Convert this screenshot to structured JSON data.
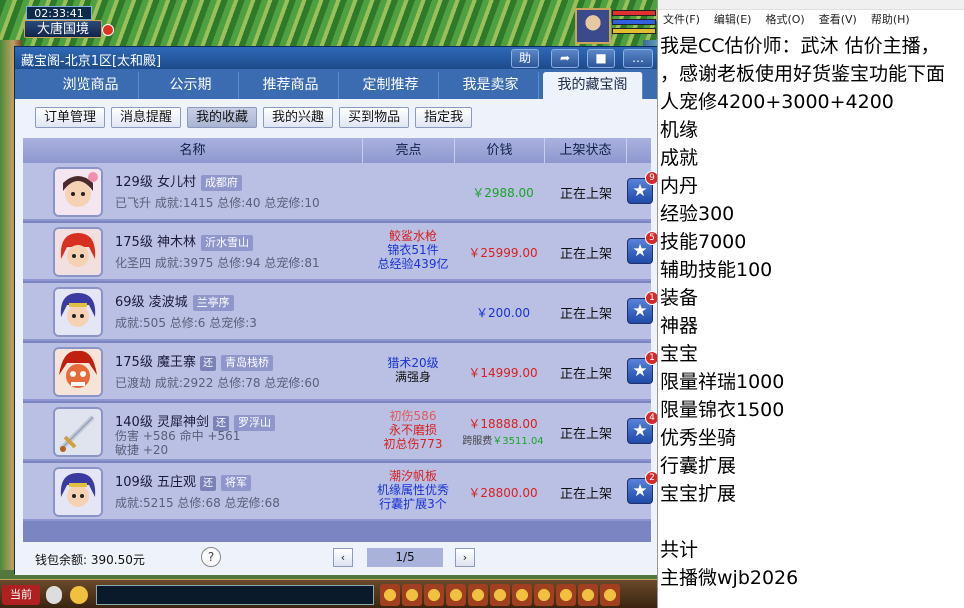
{
  "game": {
    "clock": "02:33:41",
    "map_name": "大唐国境"
  },
  "window": {
    "title": "藏宝阁-北京1区[太和殿]",
    "title_buttons": [
      "助"
    ],
    "tabs": [
      {
        "label": "浏览商品"
      },
      {
        "label": "公示期"
      },
      {
        "label": "推荐商品"
      },
      {
        "label": "定制推荐"
      },
      {
        "label": "我是卖家"
      },
      {
        "label": "我的藏宝阁"
      }
    ],
    "active_tab": "我的藏宝阁",
    "subtabs": [
      "订单管理",
      "消息提醒",
      "我的收藏",
      "我的兴趣",
      "买到物品",
      "指定我"
    ],
    "active_subtab": "我的收藏"
  },
  "table": {
    "headers": {
      "name": "名称",
      "highlight": "亮点",
      "price": "价钱",
      "status": "上架状态"
    },
    "rows": [
      {
        "line1_name": "129级  女儿村",
        "server": "成都府",
        "huan": "",
        "line2": "已飞升  成就:1415  总修:40  总宠修:10",
        "highlights": [],
        "price": "￥2988.00",
        "price_color": "#1aa32a",
        "fee": "",
        "status": "正在上架",
        "fav_count": "9",
        "avatar": "girl"
      },
      {
        "line1_name": "175级  神木林",
        "server": "沂水雪山",
        "huan": "",
        "line2": "化圣四  成就:3975  总修:94  总宠修:81",
        "highlights": [
          {
            "text": "鲛鲨水枪",
            "color": "#d82020"
          },
          {
            "text": "锦衣51件",
            "color": "#1a30d0"
          },
          {
            "text": "总经验439亿",
            "color": "#1a30d0"
          }
        ],
        "price": "￥25999.00",
        "price_color": "#d82020",
        "fee": "",
        "status": "正在上架",
        "fav_count": "5",
        "avatar": "red"
      },
      {
        "line1_name": "69级  凌波城",
        "server": "兰亭序",
        "huan": "",
        "line2": "成就:505  总修:6  总宠修:3",
        "highlights": [],
        "price": "￥200.00",
        "price_color": "#1a30d0",
        "fee": "",
        "status": "正在上架",
        "fav_count": "1",
        "avatar": "blue"
      },
      {
        "line1_name": "175级  魔王寨",
        "server": "青岛栈桥",
        "huan": "还",
        "line2": "已渡劫  成就:2922  总修:78  总宠修:60",
        "highlights": [
          {
            "text": "猎术20级",
            "color": "#1a30d0"
          },
          {
            "text": "满强身",
            "color": "#111111"
          }
        ],
        "price": "￥14999.00",
        "price_color": "#d82020",
        "fee": "",
        "status": "正在上架",
        "fav_count": "1",
        "avatar": "demon"
      },
      {
        "line1_name": "140级  灵犀神剑",
        "server": "罗浮山",
        "huan": "还",
        "line2": "伤害 +586  命中 +561",
        "line3": "敏捷 +20",
        "highlights": [
          {
            "text": "初伤586",
            "color": "#e05a5a"
          },
          {
            "text": "永不磨损",
            "color": "#d82020"
          },
          {
            "text": "初总伤773",
            "color": "#d82020"
          }
        ],
        "price": "￥18888.00",
        "price_color": "#d82020",
        "fee_label": "跨服费",
        "fee": "￥3511.04",
        "status": "正在上架",
        "fav_count": "4",
        "avatar": "sword"
      },
      {
        "line1_name": "109级  五庄观",
        "server": "将军",
        "huan": "还",
        "line2": "成就:5215  总修:68  总宠修:68",
        "highlights": [
          {
            "text": "潮汐帆板",
            "color": "#d82020"
          },
          {
            "text": "机缘属性优秀",
            "color": "#1a30d0"
          },
          {
            "text": "行囊扩展3个",
            "color": "#1a30d0"
          }
        ],
        "price": "￥28800.00",
        "price_color": "#d82020",
        "fee": "",
        "status": "正在上架",
        "fav_count": "2",
        "avatar": "blue"
      }
    ]
  },
  "footer": {
    "wallet": "钱包余额: 390.50元",
    "help": "?",
    "prev": "‹",
    "next": "›",
    "page": "1/5"
  },
  "bottombar": {
    "current": "当前"
  },
  "notepad": {
    "menu": [
      "文件(F)",
      "编辑(E)",
      "格式(O)",
      "查看(V)",
      "帮助(H)"
    ],
    "lines": [
      "我是CC估价师：武沐 估价主播，",
      "，感谢老板使用好货鉴宝功能下面",
      "人宠修4200+3000+4200",
      "机缘",
      "成就",
      "内丹",
      "经验300",
      "技能7000",
      "辅助技能100",
      "装备",
      "神器",
      "宝宝",
      "限量祥瑞1000",
      "限量锦衣1500",
      "优秀坐骑",
      "行囊扩展",
      "宝宝扩展",
      "",
      "共计",
      "主播微wjb2026"
    ]
  }
}
